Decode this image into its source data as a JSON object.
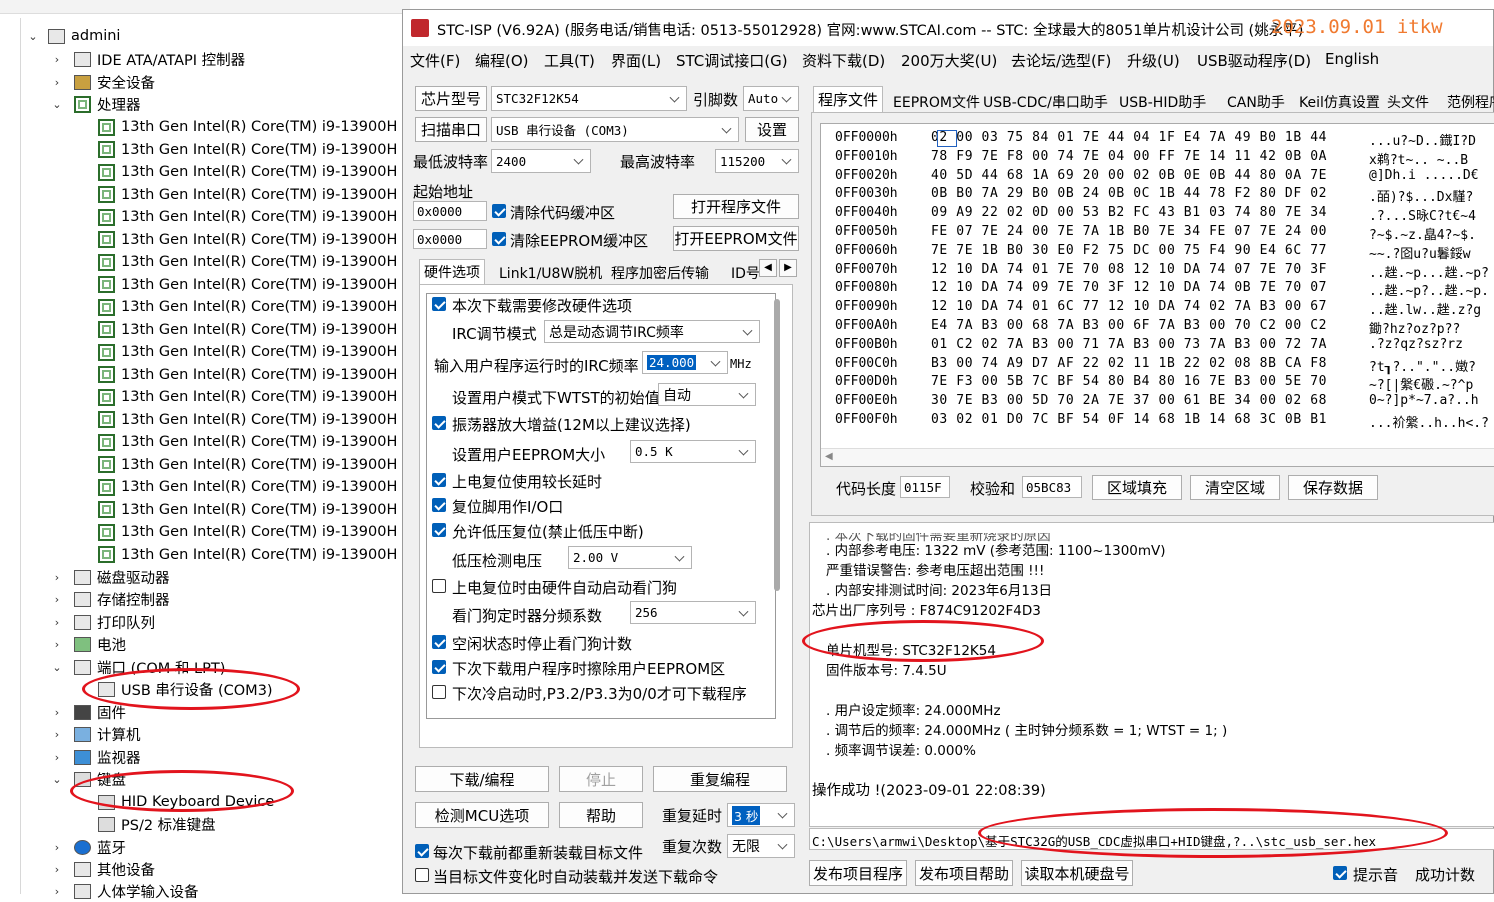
{
  "device_manager": {
    "root": "admini",
    "items": [
      {
        "label": "IDE ATA/ATAPI 控制器",
        "icon": "ide-controller-icon",
        "state": "collapsed"
      },
      {
        "label": "安全设备",
        "icon": "security-device-icon",
        "state": "collapsed"
      },
      {
        "label": "处理器",
        "icon": "processor-icon",
        "state": "expanded"
      },
      {
        "label": "磁盘驱动器",
        "icon": "disk-drive-icon",
        "state": "collapsed"
      },
      {
        "label": "存储控制器",
        "icon": "storage-controller-icon",
        "state": "collapsed"
      },
      {
        "label": "打印队列",
        "icon": "printer-icon",
        "state": "collapsed"
      },
      {
        "label": "电池",
        "icon": "battery-icon",
        "state": "collapsed"
      },
      {
        "label": "端口 (COM 和 LPT)",
        "icon": "port-icon",
        "state": "expanded"
      },
      {
        "label": "固件",
        "icon": "firmware-icon",
        "state": "collapsed"
      },
      {
        "label": "计算机",
        "icon": "computer-icon",
        "state": "collapsed"
      },
      {
        "label": "监视器",
        "icon": "monitor-icon",
        "state": "collapsed"
      },
      {
        "label": "键盘",
        "icon": "keyboard-icon",
        "state": "expanded"
      },
      {
        "label": "蓝牙",
        "icon": "bluetooth-icon",
        "state": "collapsed"
      },
      {
        "label": "其他设备",
        "icon": "other-device-icon",
        "state": "collapsed"
      },
      {
        "label": "人体学输入设备",
        "icon": "hid-icon",
        "state": "collapsed"
      }
    ],
    "cpu_name": "13th Gen Intel(R) Core(TM) i9-13900H",
    "cpu_count": 20,
    "port_child": "USB 串行设备 (COM3)",
    "keyboard_children": [
      "HID Keyboard Device",
      "PS/2 标准键盘"
    ]
  },
  "stc": {
    "title": "STC-ISP (V6.92A) (服务电话/销售电话: 0513-55012928) 官网:www.STCAI.com  -- STC: 全球最大的8051单片机设计公司 (姚永平)",
    "title_watermark": "2023.09.01 itkw",
    "menu": [
      "文件(F)",
      "编程(O)",
      "工具(T)",
      "界面(L)",
      "STC调试接口(G)",
      "资料下载(D)",
      "200万大奖(U)",
      "去论坛/选型(F)",
      "升级(U)",
      "USB驱动程序(D)",
      "English"
    ],
    "left": {
      "chip_model_btn": "芯片型号",
      "chip_model": "STC32F12K54",
      "pin_count_label": "引脚数",
      "pin_count": "Auto",
      "scan_port_btn": "扫描串口",
      "port_value": "USB 串行设备 (COM3)",
      "settings_btn": "设置",
      "min_baud_label": "最低波特率",
      "min_baud": "2400",
      "max_baud_label": "最高波特率",
      "max_baud": "115200",
      "start_addr_label": "起始地址",
      "addr1": "0x0000",
      "clear_code_label": "清除代码缓冲区",
      "open_program_btn": "打开程序文件",
      "addr2": "0x0000",
      "clear_eeprom_label": "清除EEPROM缓冲区",
      "open_eeprom_btn": "打开EEPROM文件",
      "tabs": [
        "硬件选项",
        "Link1/U8W脱机",
        "程序加密后传输",
        "ID号"
      ],
      "opts": {
        "need_modify": "本次下载需要修改硬件选项",
        "irc_mode_label": "IRC调节模式",
        "irc_mode": "总是动态调节IRC频率",
        "irc_freq_label": "输入用户程序运行时的IRC频率",
        "irc_freq": "24.000",
        "mhz": "MHz",
        "wtst_label": "设置用户模式下WTST的初始值",
        "wtst": "自动",
        "osc_gain": "振荡器放大增益(12M以上建议选择)",
        "eeprom_size_label": "设置用户EEPROM大小",
        "eeprom_size": "0.5 K",
        "long_reset": "上电复位使用较长延时",
        "reset_io": "复位脚用作I/O口",
        "lvr": "允许低压复位(禁止低压中断)",
        "lvd_label": "低压检测电压",
        "lvd": "2.00 V",
        "wdt_hw": "上电复位时由硬件自动启动看门狗",
        "wdt_div_label": "看门狗定时器分频系数",
        "wdt_div": "256",
        "idle_wdt": "空闲状态时停止看门狗计数",
        "erase_eeprom": "下次下载用户程序时擦除用户EEPROM区",
        "cold_boot": "下次冷启动时,P3.2/P3.3为0/0才可下载程序"
      },
      "download_btn": "下载/编程",
      "stop_btn": "停止",
      "repeat_btn": "重复编程",
      "check_mcu_btn": "检测MCU选项",
      "help_btn": "帮助",
      "repeat_delay_label": "重复延时",
      "repeat_delay": "3 秒",
      "repeat_count_label": "重复次数",
      "repeat_count": "无限",
      "reload_each": "每次下载前都重新装载目标文件",
      "auto_send": "当目标文件变化时自动装载并发送下载命令"
    },
    "right": {
      "tabs": [
        "程序文件",
        "EEPROM文件",
        "USB-CDC/串口助手",
        "USB-HID助手",
        "CAN助手",
        "Keil仿真设置",
        "头文件",
        "范例程序"
      ],
      "hex_rows": [
        {
          "addr": "0FF0000h",
          "bytes": "02 00 03 75 84 01 7E 44 04 1F E4 7A 49 B0 1B 44",
          "ascii": "...u?~D..鐡I?D"
        },
        {
          "addr": "0FF0010h",
          "bytes": "78 F9 7E F8 00 74 7E 04 00 FF 7E 14 11 42 0B 0A",
          "ascii": "x鹈?t~..  ~..B"
        },
        {
          "addr": "0FF0020h",
          "bytes": "40 5D 44 68 1A 69 20 00 02 0B 0E 0B 44 80 0A 7E",
          "ascii": "@]Dh.i .....D€"
        },
        {
          "addr": "0FF0030h",
          "bytes": "0B B0 7A 29 B0 0B 24 0B 0C 1B 44 78 F2 80 DF 02",
          "ascii": ".皕)?$...Dx騹?"
        },
        {
          "addr": "0FF0040h",
          "bytes": "09 A9 22 02 0D 00 53 B2 FC 43 B1 03 74 80 7E 34",
          "ascii": ".?...S昹C?t€~4"
        },
        {
          "addr": "0FF0050h",
          "bytes": "FE 07 7E 24 00 7E 7A 1B B0 7E 34 FE 07 7E 24 00",
          "ascii": "?~$.~z.皛4?~$."
        },
        {
          "addr": "0FF0060h",
          "bytes": "7E 7E 1B B0 30 E0 F2 75 DC 00 75 F4 90 E4 6C 77",
          "ascii": "~~.?囵u?u鬊鋖w"
        },
        {
          "addr": "0FF0070h",
          "bytes": "12 10 DA 74 01 7E 70 08 12 10 DA 74 07 7E 70 3F",
          "ascii": "..趖.~p...趖.~p?"
        },
        {
          "addr": "0FF0080h",
          "bytes": "12 10 DA 74 09 7E 70 3F 12 10 DA 74 0B 7E 70 07",
          "ascii": "..趖.~p?..趖.~p."
        },
        {
          "addr": "0FF0090h",
          "bytes": "12 10 DA 74 01 6C 77 12 10 DA 74 02 7A B3 00 67",
          "ascii": "..趖.lw..趖.z?g"
        },
        {
          "addr": "0FF00A0h",
          "bytes": "E4 7A B3 00 68 7A B3 00 6F 7A B3 00 70 C2 00 C2",
          "ascii": "鋤?hz?oz?p??"
        },
        {
          "addr": "0FF00B0h",
          "bytes": "01 C2 02 7A B3 00 71 7A B3 00 73 7A B3 00 72 7A",
          "ascii": ".?z?qz?sz?rz"
        },
        {
          "addr": "0FF00C0h",
          "bytes": "B3 00 74 A9 D7 AF 22 02 11 1B 22 02 08 8B CA F8",
          "ascii": "?t┒?..\".\"..嬍?"
        },
        {
          "addr": "0FF00D0h",
          "bytes": "7E F3 00 5B 7C BF 54 80 B4 80 16 7E B3 00 5E 70",
          "ascii": "~?[|縏€磤.~?^p"
        },
        {
          "addr": "0FF00E0h",
          "bytes": "30 7E B3 00 5D 70 2A 7E 37 00 61 BE 34 00 02 68",
          "ascii": "0~?]p*~7.a?..h"
        },
        {
          "addr": "0FF00F0h",
          "bytes": "03 02 01 D0 7C BF 54 0F 14 68 1B 14 68 3C 0B B1",
          "ascii": "...衸縏..h..h<.?"
        }
      ],
      "code_len_label": "代码长度",
      "code_len": "0115F",
      "checksum_label": "校验和",
      "checksum": "05BC83",
      "fill_btn": "区域填充",
      "clear_btn": "清空区域",
      "save_btn": "保存数据",
      "log": [
        ". 内部参考电压: 1322 mV (参考范围: 1100~1300mV)",
        "严重错误警告: 参考电压超出范围 !!!",
        ". 内部安排测试时间: 2023年6月13日",
        "芯片出厂序列号 : F874C91202F4D3",
        "单片机型号: STC32F12K54",
        "固件版本号: 7.4.5U",
        ". 用户设定频率: 24.000MHz",
        ". 调节后的频率: 24.000MHz ( 主时钟分频系数 = 1;  WTST = 1; )",
        ". 频率调节误差: 0.000%",
        "操作成功 !(2023-09-01 22:08:39)"
      ],
      "path": "C:\\Users\\armwi\\Desktop\\基于STC32G的USB_CDC虚拟串口+HID键盘,?..\\stc_usb_ser.hex",
      "publish_btn": "发布项目程序",
      "publish_help_btn": "发布项目帮助",
      "read_disk_btn": "读取本机硬盘号",
      "sound_label": "提示音",
      "success_count_label": "成功计数"
    }
  },
  "colors": {
    "accent": "#005fb8",
    "annotation": "#e2141d",
    "watermark": "#f07a30"
  }
}
